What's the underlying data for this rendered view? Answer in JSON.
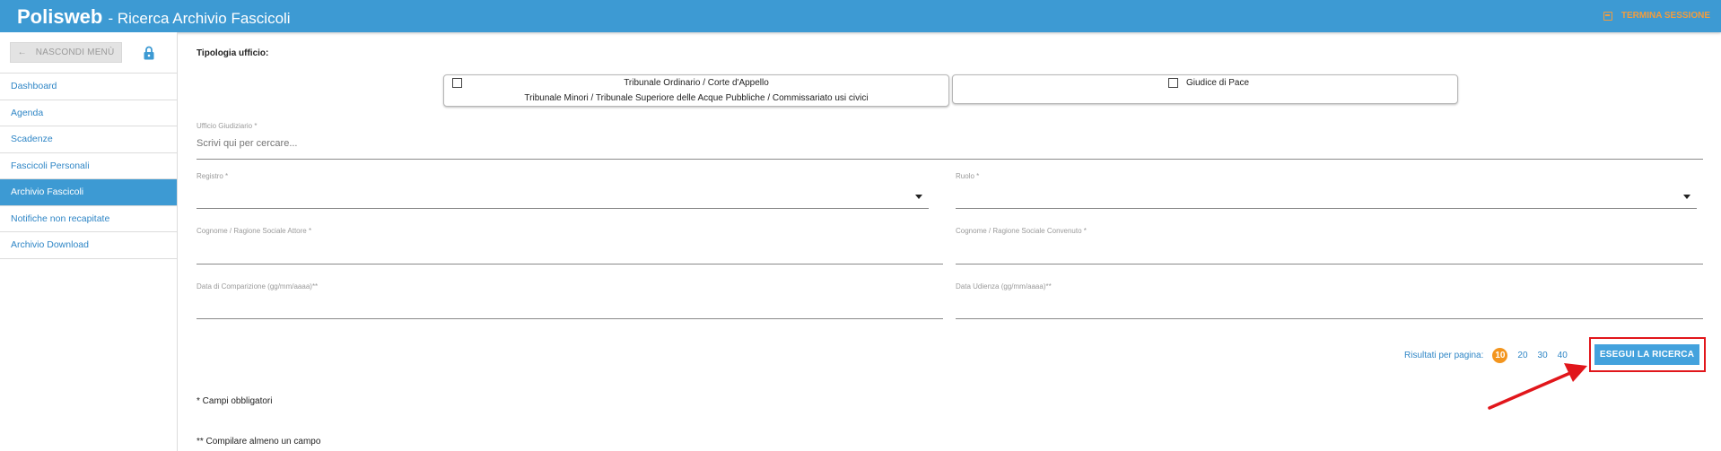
{
  "header": {
    "brand": "Polisweb",
    "subtitle": "- Ricerca Archivio Fascicoli",
    "logout_label": "TERMINA SESSIONE",
    "logout_icon": "logout-icon"
  },
  "sidebar": {
    "hide_menu_label": "NASCONDI MENÙ",
    "items": [
      {
        "label": "Dashboard",
        "active": false
      },
      {
        "label": "Agenda",
        "active": false
      },
      {
        "label": "Scadenze",
        "active": false
      },
      {
        "label": "Fascicoli Personali",
        "active": false
      },
      {
        "label": "Archivio Fascicoli",
        "active": true
      },
      {
        "label": "Notifiche non recapitate",
        "active": false
      },
      {
        "label": "Archivio Download",
        "active": false
      }
    ]
  },
  "form": {
    "tipologia_label": "Tipologia ufficio:",
    "office_option_1_line1": "Tribunale Ordinario / Corte d'Appello",
    "office_option_1_line2": "Tribunale Minori / Tribunale Superiore delle Acque Pubbliche / Commissariato usi civici",
    "office_option_2": "Giudice di Pace",
    "ufficio_label": "Ufficio Giudiziario *",
    "ufficio_placeholder": "Scrivi qui per cercare...",
    "registro_label": "Registro *",
    "ruolo_label": "Ruolo *",
    "attore_label": "Cognome / Ragione Sociale Attore *",
    "convenuto_label": "Cognome / Ragione Sociale Convenuto *",
    "data_comparizione_label": "Data di Comparizione (gg/mm/aaaa)**",
    "data_udienza_label": "Data Udienza (gg/mm/aaaa)**",
    "results_per_page_label": "Risultati per pagina:",
    "page_sizes": [
      "10",
      "20",
      "30",
      "40"
    ],
    "selected_page_size": "10",
    "search_button": "ESEGUI LA RICERCA",
    "note_required": "* Campi obbligatori",
    "note_atleast": "** Compilare almeno un campo"
  },
  "colors": {
    "header_bg": "#3d9ad3",
    "accent_orange": "#f3951e",
    "annotation_red": "#e1161b"
  }
}
